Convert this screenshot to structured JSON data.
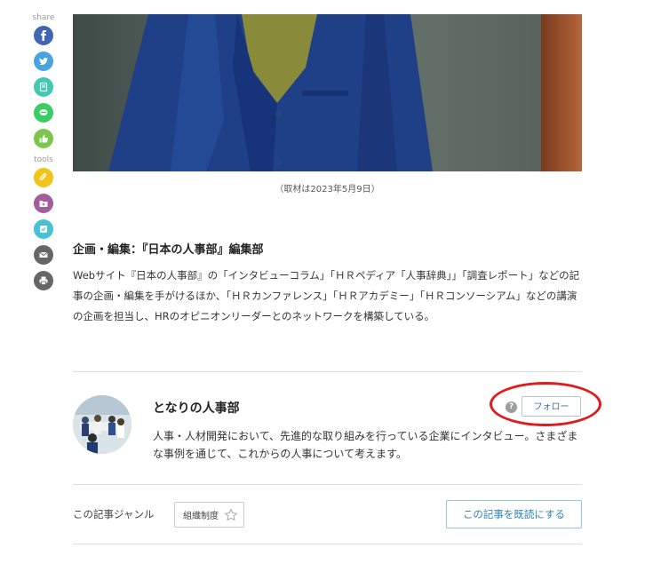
{
  "sidebar": {
    "share_label": "share",
    "tools_label": "tools",
    "share_icons": [
      {
        "name": "facebook-icon",
        "color": "#4267b2"
      },
      {
        "name": "twitter-icon",
        "color": "#4aa3df"
      },
      {
        "name": "note-icon",
        "color": "#41c9b4"
      },
      {
        "name": "line-icon",
        "color": "#3acd65"
      },
      {
        "name": "like-icon",
        "color": "#7bc74d"
      }
    ],
    "tool_icons": [
      {
        "name": "clip-icon",
        "color": "#f0c419"
      },
      {
        "name": "folder-add-icon",
        "color": "#a35e9a"
      },
      {
        "name": "checklist-icon",
        "color": "#48c1d6"
      },
      {
        "name": "mail-icon",
        "color": "#666666"
      },
      {
        "name": "print-icon",
        "color": "#666666"
      }
    ]
  },
  "article": {
    "photo_caption": "（取材は2023年5月9日）",
    "editor_title": "企画・編集：『日本の人事部』編集部",
    "editor_description": "Webサイト『日本の人事部』の「インタビューコラム」「ＨＲペディア「人事辞典」」「調査レポート」などの記事の企画・編集を手がけるほか、「ＨＲカンファレンス」「ＨＲアカデミー」「ＨＲコンソーシアム」などの講演の企画を担当し、HRのオピニオンリーダーとのネットワークを構築している。"
  },
  "series": {
    "title": "となりの人事部",
    "help_mark": "?",
    "follow_label": "フォロー",
    "description": "人事・人材開発において、先進的な取り組みを行っている企業にインタビュー。さまざまな事例を通じて、これからの人事について考えます。"
  },
  "genre": {
    "label": "この記事ジャンル",
    "tag": "組織制度",
    "mark_read_label": "この記事を既読にする"
  },
  "colors": {
    "accent_red": "#e01b1b",
    "link_blue": "#2e85b5",
    "divider": "#dddddd"
  }
}
